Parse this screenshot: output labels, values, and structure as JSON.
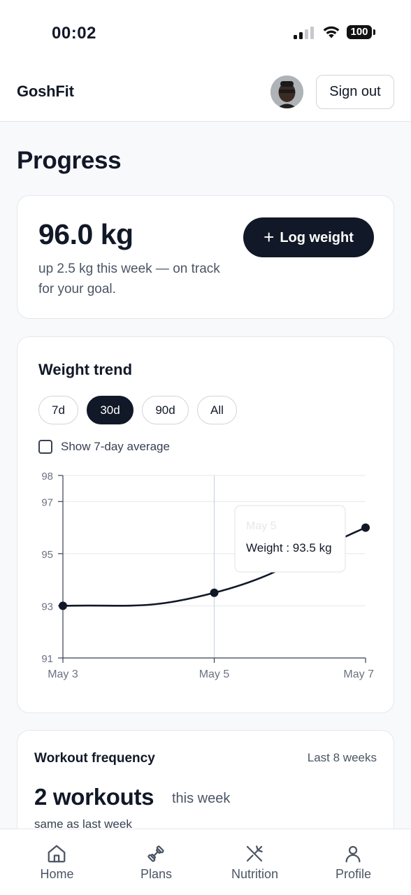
{
  "status_bar": {
    "time": "00:02",
    "battery": "100"
  },
  "header": {
    "brand": "GoshFit",
    "sign_out": "Sign out"
  },
  "page": {
    "title": "Progress"
  },
  "weight_card": {
    "value": "96.0 kg",
    "subtitle": "up 2.5 kg this week — on track for your goal.",
    "log_button": "Log weight",
    "log_icon": "+"
  },
  "trend": {
    "title": "Weight trend",
    "ranges": [
      "7d",
      "30d",
      "90d",
      "All"
    ],
    "active_range": "30d",
    "avg_label": "Show 7-day average",
    "avg_checked": false
  },
  "chart_data": {
    "type": "line",
    "x": [
      "May 3",
      "May 5",
      "May 7"
    ],
    "series": [
      {
        "values": [
          93,
          93.5,
          96
        ]
      }
    ],
    "y_ticks": [
      91,
      93,
      95,
      97,
      98
    ],
    "ylim": [
      91,
      98
    ],
    "grid": true,
    "tooltip": {
      "title": "May 5",
      "label": "Weight : 93.5 kg"
    },
    "line_color": "#111827"
  },
  "workouts": {
    "title": "Workout frequency",
    "range": "Last 8 weeks",
    "count": "2 workouts",
    "unit": "this week",
    "compare": "same as last week"
  },
  "tabs": [
    {
      "label": "Home",
      "icon": "home-icon"
    },
    {
      "label": "Plans",
      "icon": "dumbbell-icon"
    },
    {
      "label": "Nutrition",
      "icon": "utensils-icon"
    },
    {
      "label": "Profile",
      "icon": "user-icon"
    }
  ],
  "colors": {
    "primary": "#111827",
    "border": "#e5e7eb",
    "muted": "#4b5563"
  }
}
